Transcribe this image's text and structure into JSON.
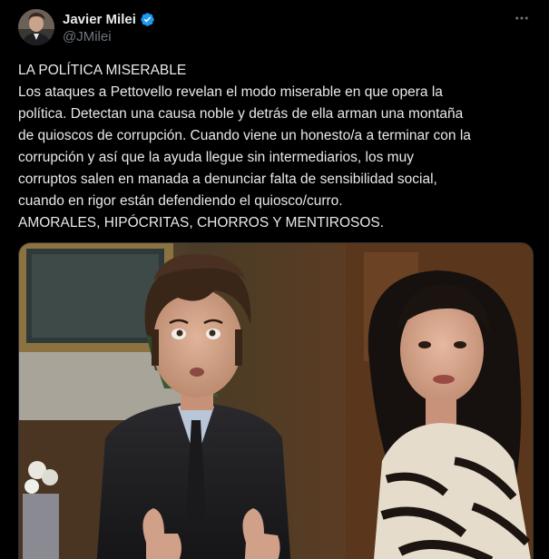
{
  "author": {
    "display_name": "Javier Milei",
    "handle": "@JMilei",
    "verified": true,
    "avatar_icon": "profile-photo"
  },
  "post": {
    "lines": [
      "LA POLÍTICA MISERABLE",
      "Los ataques a Pettovello revelan el modo miserable en que opera la",
      "política. Detectan una causa noble y detrás de ella arman una montaña",
      "de quioscos de corrupción. Cuando viene un honesto/a a terminar con la",
      "corrupción y así que la ayuda llegue sin intermediarios, los muy",
      "corruptos salen en manada a denunciar falta de sensibilidad social,",
      "cuando en rigor están defendiendo el quiosco/curro.",
      "AMORALES, HIPÓCRITAS, CHORROS Y MENTIROSOS."
    ]
  },
  "media": {
    "type": "photo",
    "description_icon": "photo-two-people"
  },
  "colors": {
    "background": "#000000",
    "text": "#e7e9ea",
    "secondary_text": "#71767b",
    "verified_badge": "#1d9bf0"
  },
  "icons": {
    "verified": "verified-badge-icon",
    "more": "more-options-icon"
  }
}
